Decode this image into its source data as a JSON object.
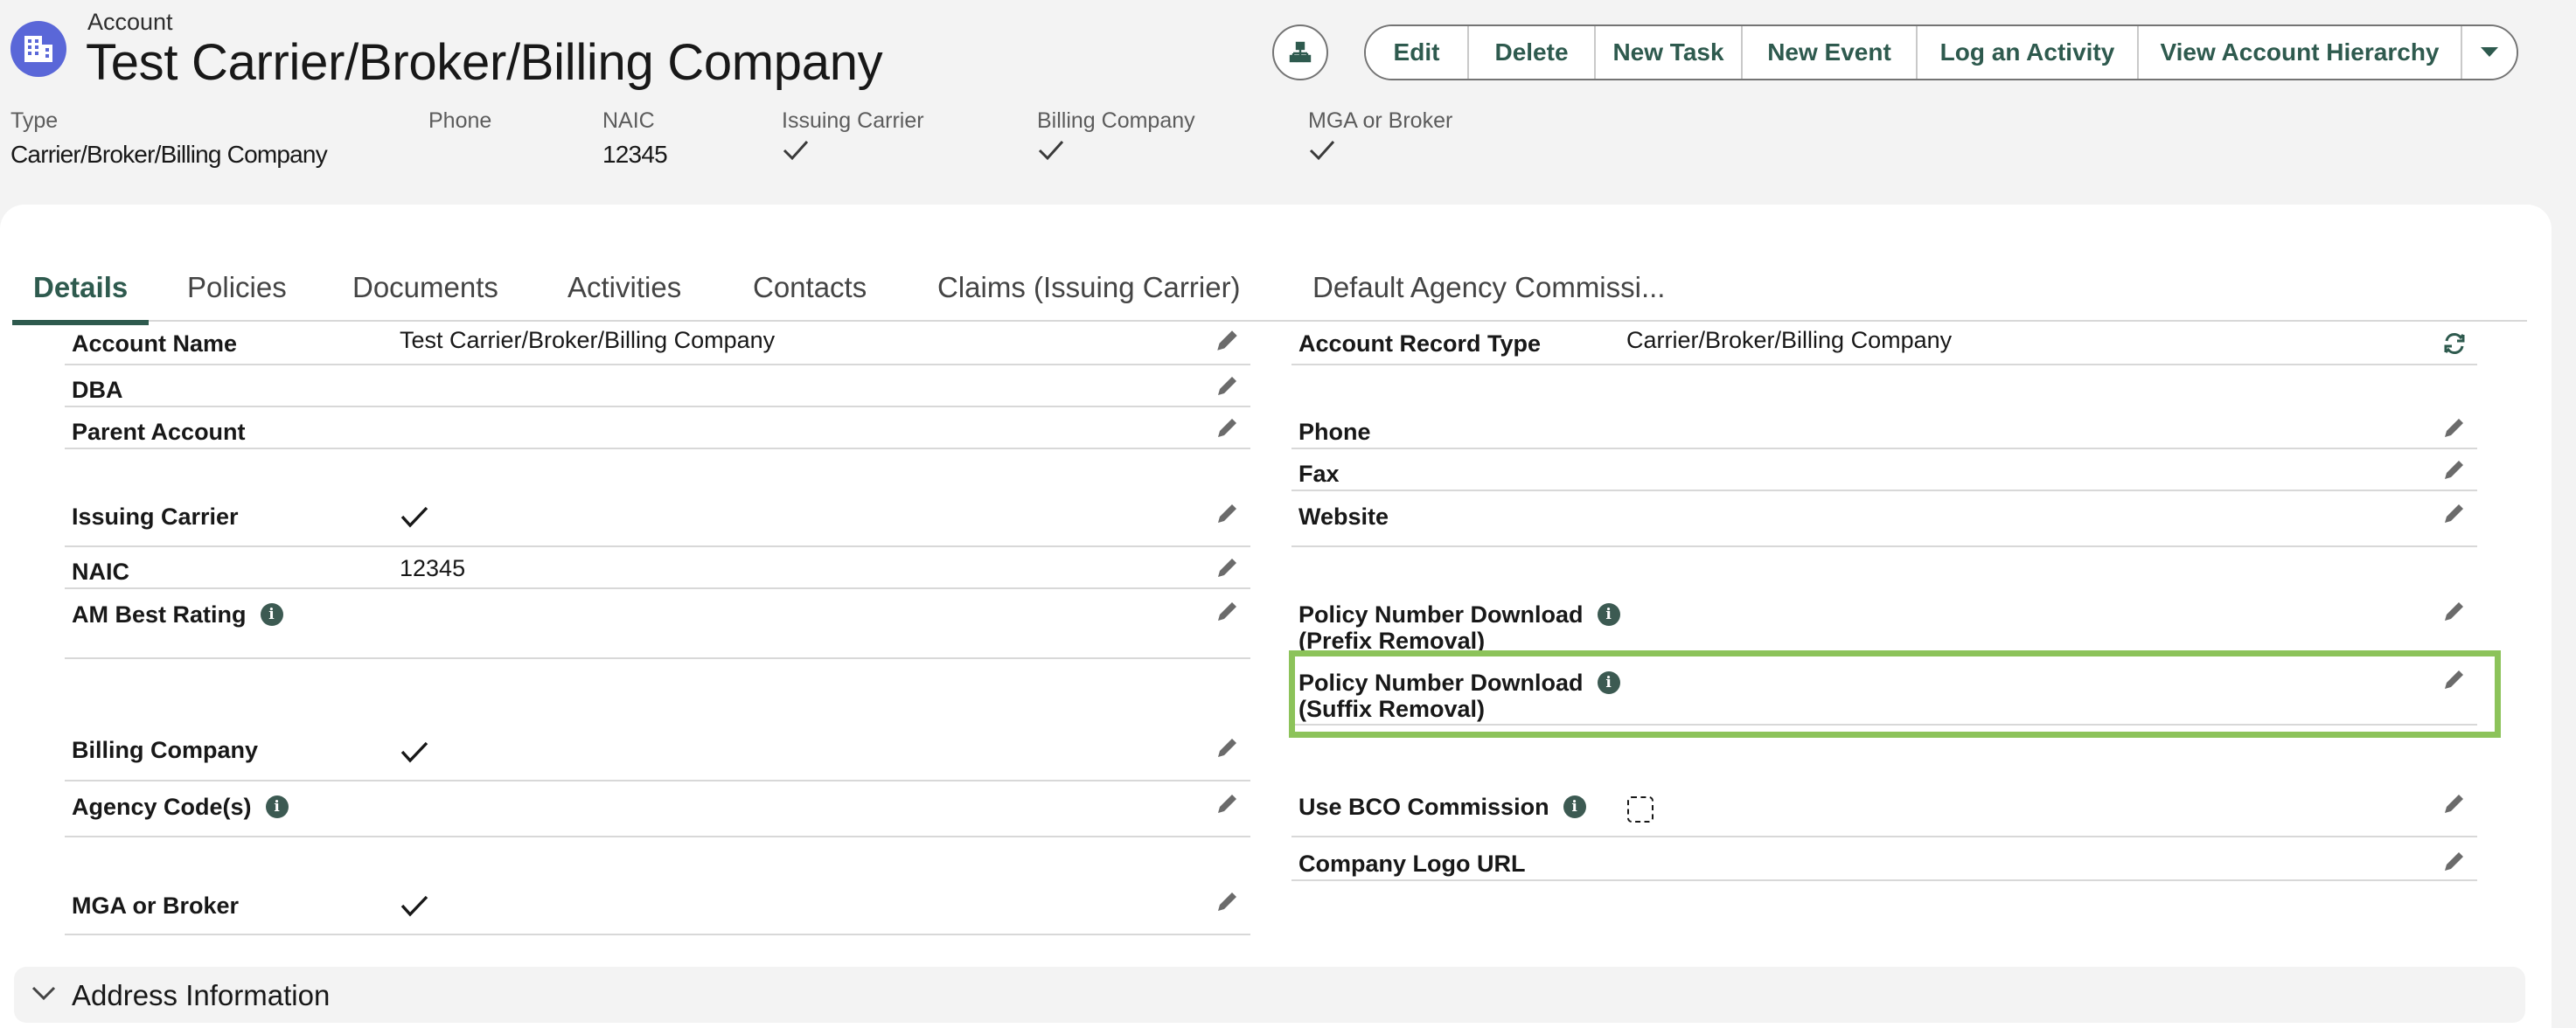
{
  "header": {
    "object_label": "Account",
    "record_title": "Test Carrier/Broker/Billing Company",
    "app_icon": "building-icon",
    "hierarchy_icon": "hierarchy-icon"
  },
  "actions": {
    "edit": "Edit",
    "delete": "Delete",
    "new_task": "New Task",
    "new_event": "New Event",
    "log_activity": "Log an Activity",
    "view_hierarchy": "View Account Hierarchy",
    "more_icon": "chevron-down-icon"
  },
  "highlights": {
    "type_label": "Type",
    "type_value": "Carrier/Broker/Billing Company",
    "phone_label": "Phone",
    "naic_label": "NAIC",
    "naic_value": "12345",
    "issuing_carrier_label": "Issuing Carrier",
    "billing_company_label": "Billing Company",
    "mga_broker_label": "MGA or Broker"
  },
  "tabs": [
    "Details",
    "Policies",
    "Documents",
    "Activities",
    "Contacts",
    "Claims (Issuing Carrier)",
    "Default Agency Commissi..."
  ],
  "active_tab": "Details",
  "left_fields": {
    "account_name": {
      "label": "Account Name",
      "value": "Test Carrier/Broker/Billing Company"
    },
    "dba": {
      "label": "DBA"
    },
    "parent_account": {
      "label": "Parent Account"
    },
    "issuing_carrier": {
      "label": "Issuing Carrier",
      "checked": true
    },
    "naic": {
      "label": "NAIC",
      "value": "12345"
    },
    "am_best_rating": {
      "label": "AM Best Rating"
    },
    "billing_company": {
      "label": "Billing Company",
      "checked": true
    },
    "agency_codes": {
      "label": "Agency Code(s)"
    },
    "mga_or_broker": {
      "label": "MGA or Broker",
      "checked": true
    }
  },
  "right_fields": {
    "account_record_type": {
      "label": "Account Record Type",
      "value": "Carrier/Broker/Billing Company"
    },
    "phone": {
      "label": "Phone"
    },
    "fax": {
      "label": "Fax"
    },
    "website": {
      "label": "Website"
    },
    "policy_prefix": {
      "label_line1": "Policy Number Download",
      "label_line2": "(Prefix Removal)"
    },
    "policy_suffix": {
      "label_line1": "Policy Number Download",
      "label_line2": "(Suffix Removal)"
    },
    "use_bco_commission": {
      "label": "Use BCO Commission",
      "checked": false
    },
    "company_logo_url": {
      "label": "Company Logo URL"
    }
  },
  "info_glyph": "i",
  "sections": {
    "address_information": "Address Information"
  },
  "colors": {
    "brand_green": "#2e5a4e",
    "app_icon_bg": "#5a67d8",
    "highlight_border": "#8cc35a"
  }
}
